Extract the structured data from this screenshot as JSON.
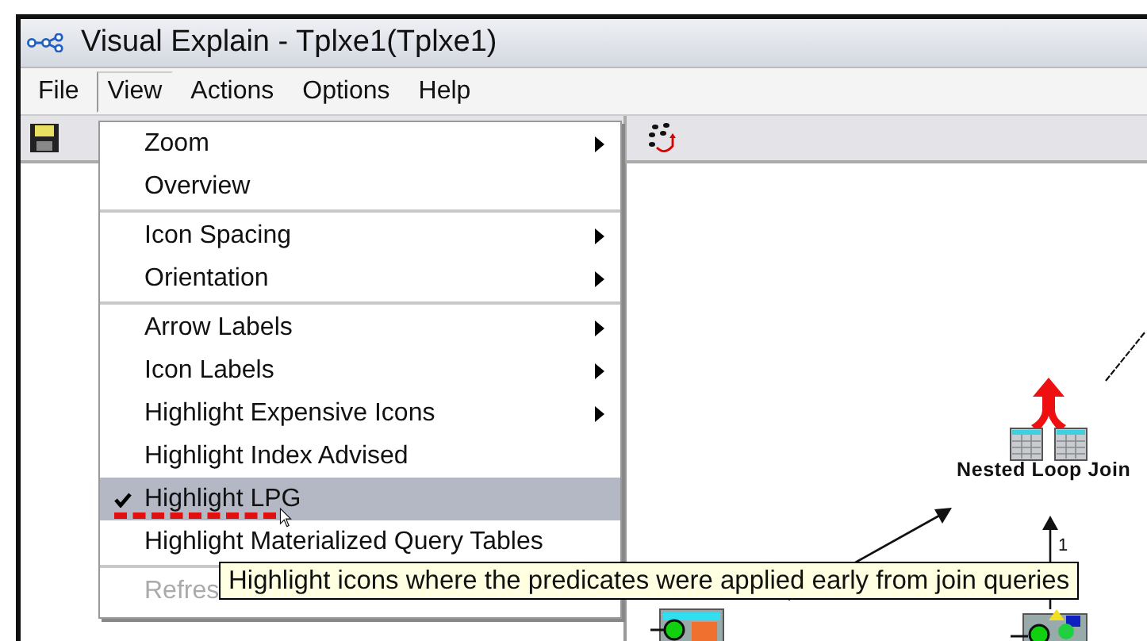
{
  "window": {
    "title": "Visual Explain - Tplxe1(Tplxe1)"
  },
  "menu_bar": [
    {
      "label": "File",
      "selected": false
    },
    {
      "label": "View",
      "selected": true
    },
    {
      "label": "Actions",
      "selected": false
    },
    {
      "label": "Options",
      "selected": false
    },
    {
      "label": "Help",
      "selected": false
    }
  ],
  "view_menu": [
    {
      "kind": "item",
      "label": "Zoom",
      "submenu": true,
      "checked": false,
      "selected": false,
      "disabled": false
    },
    {
      "kind": "item",
      "label": "Overview",
      "submenu": false,
      "checked": false,
      "selected": false,
      "disabled": false
    },
    {
      "kind": "separator"
    },
    {
      "kind": "item",
      "label": "Icon Spacing",
      "submenu": true,
      "checked": false,
      "selected": false,
      "disabled": false
    },
    {
      "kind": "item",
      "label": "Orientation",
      "submenu": true,
      "checked": false,
      "selected": false,
      "disabled": false
    },
    {
      "kind": "separator"
    },
    {
      "kind": "item",
      "label": "Arrow Labels",
      "submenu": true,
      "checked": false,
      "selected": false,
      "disabled": false
    },
    {
      "kind": "item",
      "label": "Icon Labels",
      "submenu": true,
      "checked": false,
      "selected": false,
      "disabled": false
    },
    {
      "kind": "item",
      "label": "Highlight Expensive Icons",
      "submenu": true,
      "checked": false,
      "selected": false,
      "disabled": false
    },
    {
      "kind": "item",
      "label": "Highlight Index Advised",
      "submenu": false,
      "checked": false,
      "selected": false,
      "disabled": false
    },
    {
      "kind": "item",
      "label": "Highlight LPG",
      "submenu": false,
      "checked": true,
      "selected": true,
      "disabled": false
    },
    {
      "kind": "item",
      "label": "Highlight Materialized Query Tables",
      "submenu": false,
      "checked": false,
      "selected": false,
      "disabled": false
    },
    {
      "kind": "separator"
    },
    {
      "kind": "item",
      "label": "Refres",
      "submenu": false,
      "checked": false,
      "selected": false,
      "disabled": true
    }
  ],
  "tooltip": "Highlight icons where the predicates were applied early from join queries",
  "diagram": {
    "node_label": "Nested Loop Join",
    "arrow_label": "1"
  }
}
